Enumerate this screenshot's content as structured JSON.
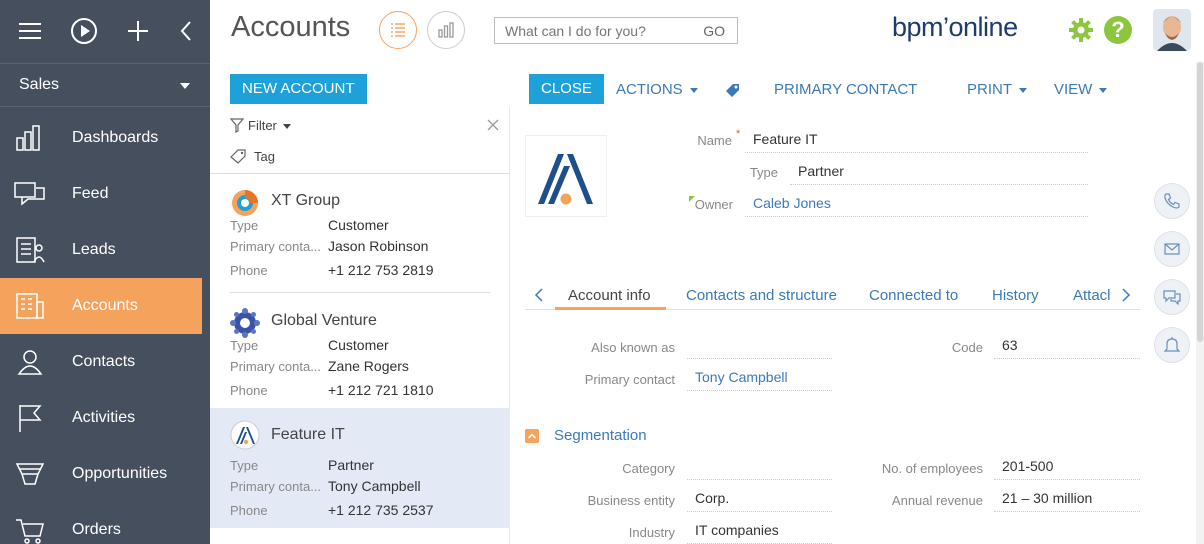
{
  "app": {
    "workspace": "Sales",
    "logo_text": "bpm’online",
    "help_label": "?"
  },
  "nav": [
    {
      "label": "Dashboards",
      "icon": "dashboards-icon"
    },
    {
      "label": "Feed",
      "icon": "feed-icon"
    },
    {
      "label": "Leads",
      "icon": "leads-icon"
    },
    {
      "label": "Accounts",
      "icon": "accounts-icon",
      "active": true
    },
    {
      "label": "Contacts",
      "icon": "contacts-icon"
    },
    {
      "label": "Activities",
      "icon": "activities-icon"
    },
    {
      "label": "Opportunities",
      "icon": "opportunities-icon"
    },
    {
      "label": "Orders",
      "icon": "orders-icon"
    }
  ],
  "header": {
    "title": "Accounts",
    "search_placeholder": "What can I do for you?",
    "search_go": "GO"
  },
  "toolbar": {
    "new_account": "NEW ACCOUNT",
    "close": "CLOSE",
    "actions": "ACTIONS",
    "primary_contact": "PRIMARY CONTACT",
    "print": "PRINT",
    "view": "VIEW"
  },
  "list": {
    "filter": "Filter",
    "tag": "Tag",
    "records": [
      {
        "name": "XT Group",
        "type_label": "Type",
        "type": "Customer",
        "contact_label": "Primary conta...",
        "contact": "Jason Robinson",
        "phone_label": "Phone",
        "phone": "+1 212 753 2819"
      },
      {
        "name": "Global Venture",
        "type_label": "Type",
        "type": "Customer",
        "contact_label": "Primary conta...",
        "contact": "Zane Rogers",
        "phone_label": "Phone",
        "phone": "+1 212 721 1810"
      },
      {
        "name": "Feature IT",
        "type_label": "Type",
        "type": "Partner",
        "contact_label": "Primary conta...",
        "contact": "Tony Campbell",
        "phone_label": "Phone",
        "phone": "+1 212 735 2537",
        "active": true
      }
    ]
  },
  "detail": {
    "name_label": "Name",
    "name_required": "*",
    "name": "Feature IT",
    "type_label": "Type",
    "type": "Partner",
    "owner_label": "Owner",
    "owner": "Caleb Jones",
    "tabs": [
      "Account info",
      "Contacts and structure",
      "Connected to",
      "History",
      "Attacl"
    ],
    "active_tab": "Account info",
    "also_known_label": "Also known as",
    "also_known": "",
    "code_label": "Code",
    "code": "63",
    "primary_contact_label": "Primary contact",
    "primary_contact": "Tony Campbell",
    "segmentation_title": "Segmentation",
    "category_label": "Category",
    "category": "",
    "employees_label": "No. of employees",
    "employees": "201-500",
    "business_entity_label": "Business entity",
    "business_entity": "Corp.",
    "revenue_label": "Annual revenue",
    "revenue": "21 – 30 million",
    "industry_label": "Industry",
    "industry": "IT companies"
  },
  "colors": {
    "sidebar": "#464f5e",
    "accent_orange": "#f5a25d",
    "primary_blue": "#1ea1d8",
    "link_blue": "#3b7ab8",
    "green": "#8cc63f"
  }
}
